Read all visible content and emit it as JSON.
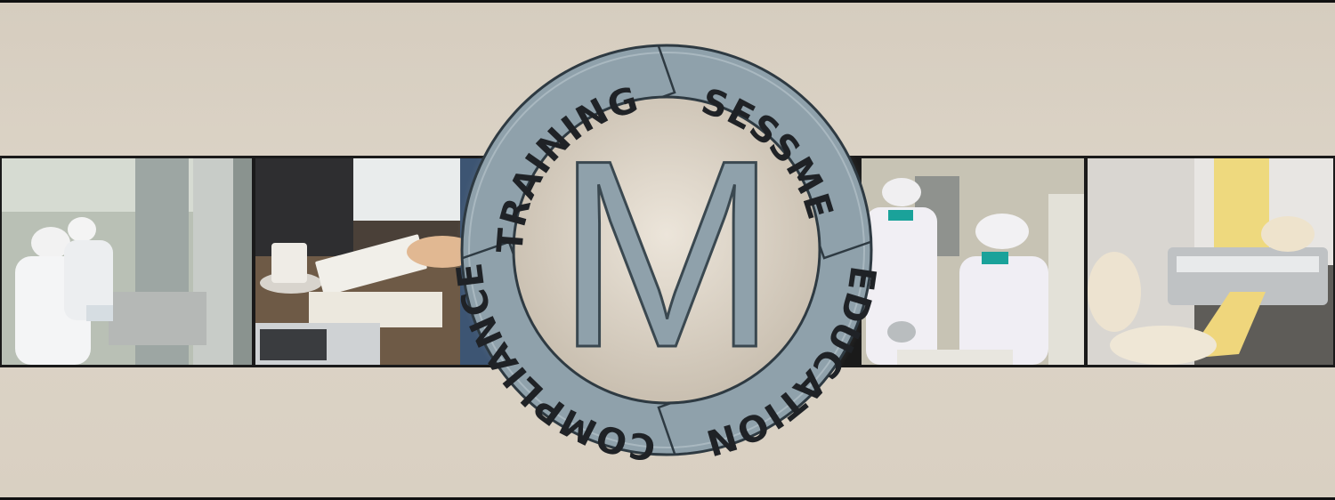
{
  "banner": {
    "center_letter": "M",
    "ring_words": {
      "top_left": "TRAINING",
      "top_right": "ASSESSMENT",
      "bottom_right": "EDUCATION",
      "bottom_left": "COMPLIANCE"
    }
  },
  "photos": [
    {
      "icon": "factory-workers-photo"
    },
    {
      "icon": "desk-notebook-laptop-photo"
    },
    {
      "icon": "lab-workers-photo"
    },
    {
      "icon": "pasta-machine-photo"
    }
  ],
  "colors": {
    "background": "#d8cfc1",
    "ring": "#8fa1ab",
    "text": "#1f2226"
  }
}
